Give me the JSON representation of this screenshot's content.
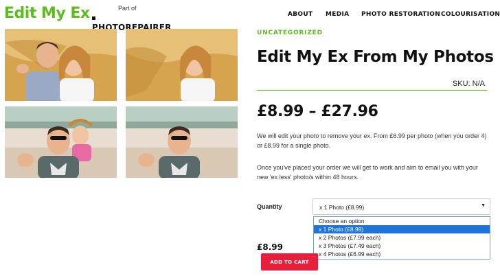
{
  "header": {
    "logo_text": "Edit My Ex",
    "part_of_label": "Part of",
    "partner_brand": "PHOTOREPAIRER",
    "nav": [
      {
        "label": "ABOUT"
      },
      {
        "label": "MEDIA"
      },
      {
        "label": "PHOTO RESTORATION"
      },
      {
        "label": "COLOURISATION"
      }
    ]
  },
  "product": {
    "category": "UNCATEGORIZED",
    "title": "Edit My Ex From My Photos",
    "sku": "SKU: N/A",
    "price_range": "£8.99 – £27.96",
    "description": [
      "We will edit your photo to remove your ex. From £6.99 per photo (when you order 4) or £8.99 for a single photo.",
      "Once you've placed your order we will get to work and aim to email you with your new 'ex less' photo/s within 48 hours."
    ],
    "quantity_label": "Quantity",
    "quantity_selected": "x 1 Photo (£8.99)",
    "quantity_options": [
      "Choose an option",
      "x 1 Photo (£8.99)",
      "x 2 Photos (£7.99 each)",
      "x 3 Photos (£7.49 each)",
      "x 4 Photos (£6.99 each)"
    ],
    "highlighted_option_index": 1,
    "unit_price": "£8.99",
    "add_to_cart_label": "ADD TO CART"
  },
  "gallery": {
    "images": [
      {
        "icon": "couple-on-hay-photo"
      },
      {
        "icon": "woman-on-hay-photo"
      },
      {
        "icon": "couple-on-beach-photo"
      },
      {
        "icon": "man-on-beach-photo"
      }
    ]
  },
  "colors": {
    "brand_green": "#5cbd1e",
    "button_red": "#e6203c",
    "highlight_blue": "#1e74d8"
  }
}
